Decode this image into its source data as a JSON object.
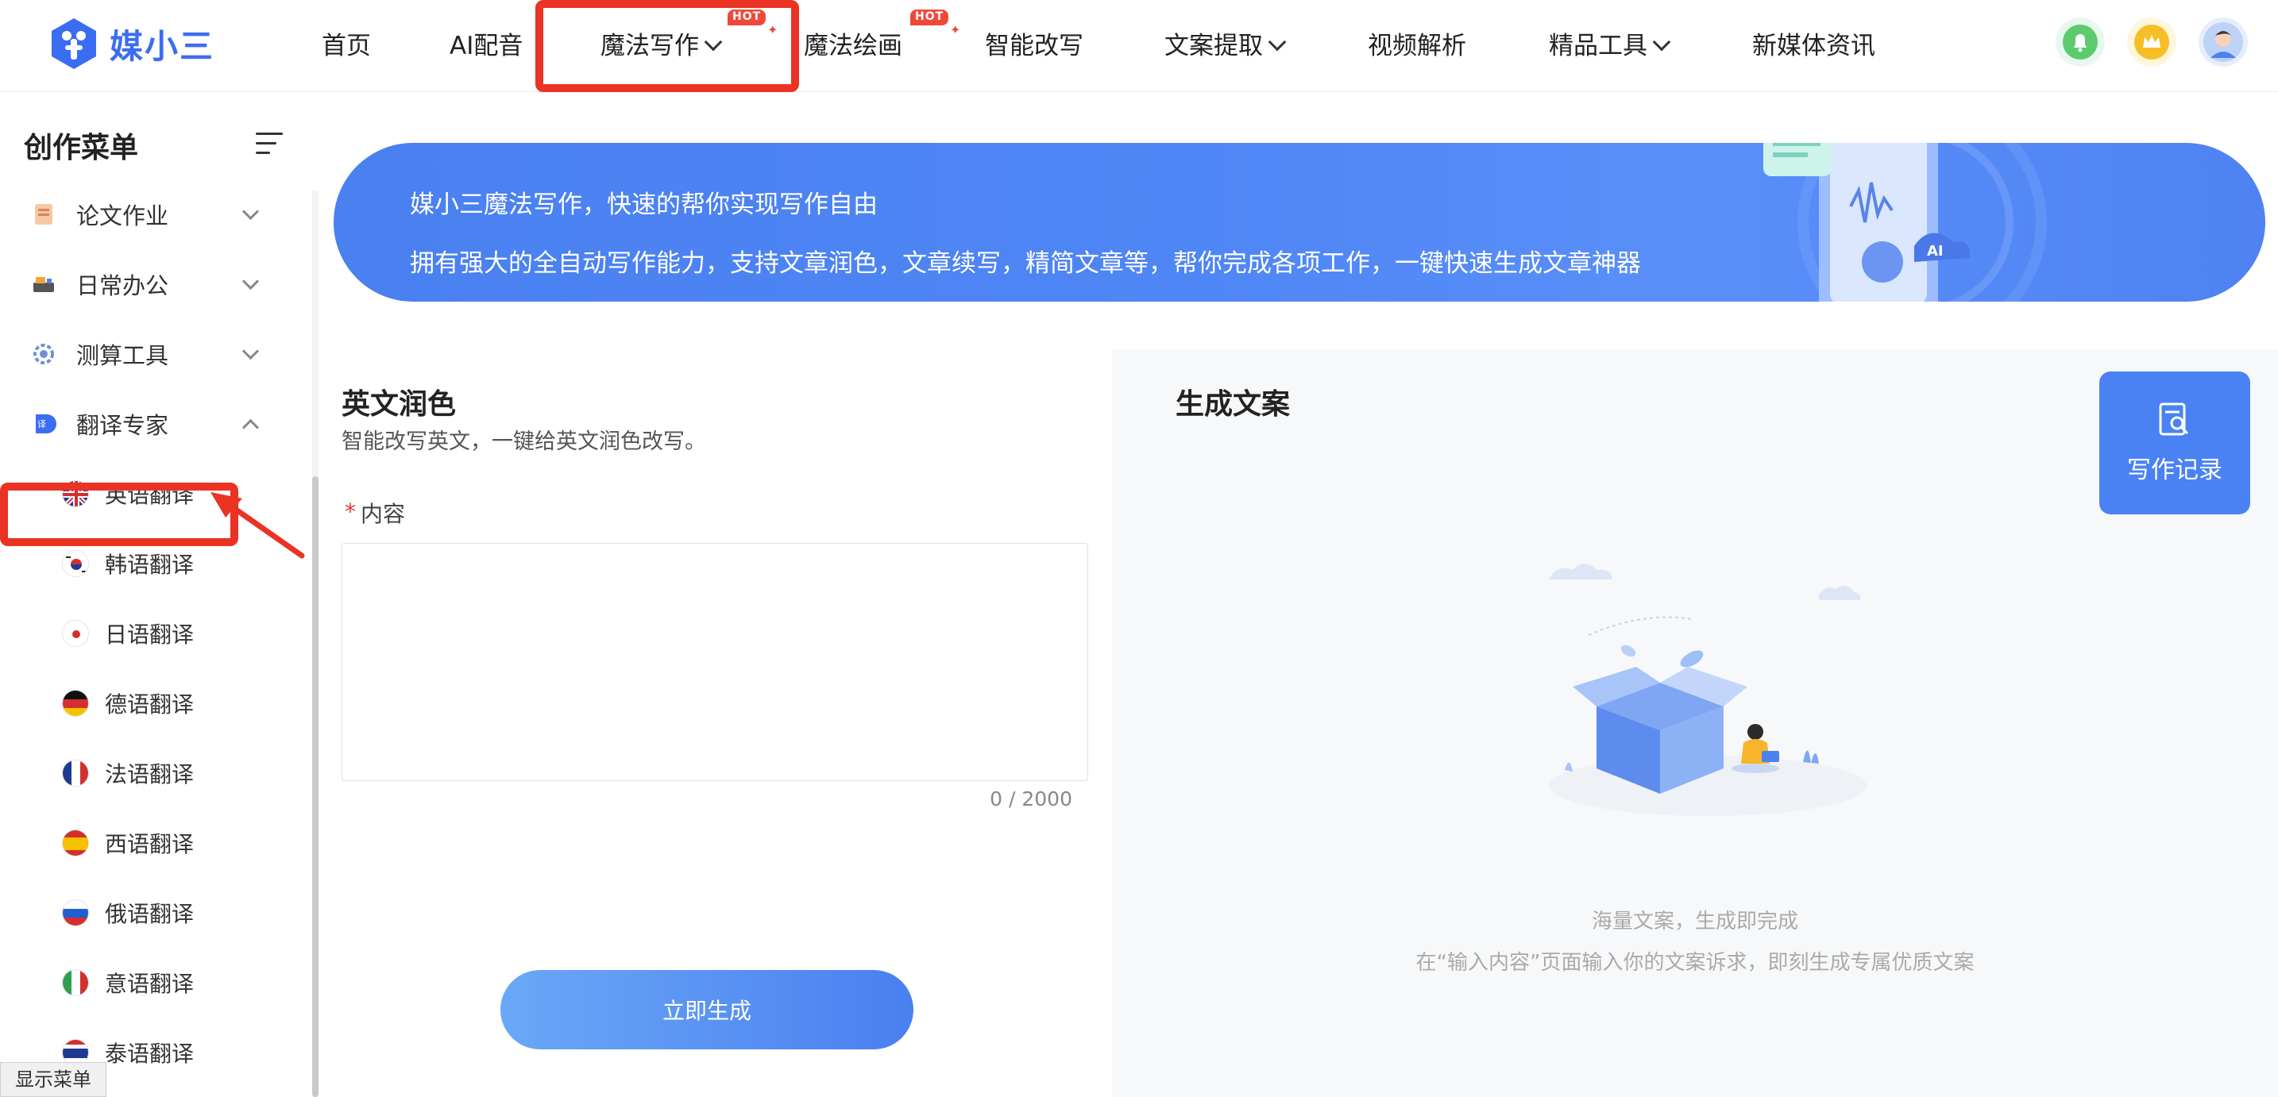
{
  "brand": {
    "name": "媒小三"
  },
  "nav": {
    "items": [
      {
        "label": "首页"
      },
      {
        "label": "AI配音"
      },
      {
        "label": "魔法写作",
        "badge": "HOT"
      },
      {
        "label": "魔法绘画",
        "badge": "HOT"
      },
      {
        "label": "智能改写"
      },
      {
        "label": "文案提取"
      },
      {
        "label": "视频解析"
      },
      {
        "label": "精品工具"
      },
      {
        "label": "新媒体资讯"
      }
    ],
    "right_icons": [
      "bell-icon",
      "crown-icon",
      "avatar"
    ]
  },
  "sidebar": {
    "title": "创作菜单",
    "categories": [
      {
        "label": "论文作业"
      },
      {
        "label": "日常办公"
      },
      {
        "label": "测算工具"
      },
      {
        "label": "翻译专家"
      }
    ],
    "sub_items": [
      {
        "label": "英语翻译"
      },
      {
        "label": "韩语翻译"
      },
      {
        "label": "日语翻译"
      },
      {
        "label": "德语翻译"
      },
      {
        "label": "法语翻译"
      },
      {
        "label": "西语翻译"
      },
      {
        "label": "俄语翻译"
      },
      {
        "label": "意语翻译"
      },
      {
        "label": "泰语翻译"
      }
    ],
    "show_menu": "显示菜单"
  },
  "banner": {
    "line1": "媒小三魔法写作，快速的帮你实现写作自由",
    "line2": "拥有强大的全自动写作能力，支持文章润色，文章续写，精简文章等，帮你完成各项工作，一键快速生成文章神器",
    "art_text": "AI"
  },
  "form": {
    "title": "英文润色",
    "description": "智能改写英文，一键给英文润色改写。",
    "required_mark": "*",
    "content_label": "内容",
    "content_value": "",
    "counter": "0 / 2000",
    "submit_label": "立即生成"
  },
  "result": {
    "title": "生成文案",
    "record_label": "写作记录",
    "empty_line1": "海量文案，生成即完成",
    "empty_line2": "在“输入内容”页面输入你的文案诉求，即刻生成专属优质文案"
  },
  "colors": {
    "accent": "#4a82f4",
    "annotation_red": "#ea3323",
    "hot_badge": "#f0493a"
  }
}
